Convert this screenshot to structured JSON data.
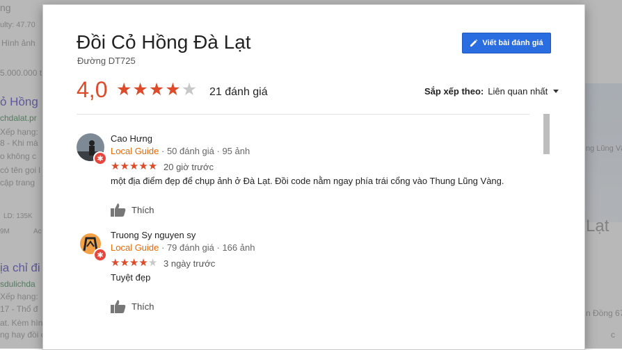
{
  "background": {
    "snippets": [
      "ng",
      "ulty: 47.70",
      "Hình ảnh",
      "5.000.000 t",
      "ỏ Hồng",
      "chdalat.pr",
      "Xếp hạng:",
      "8 - Khi mà",
      "o không c",
      "có tên gọi l",
      "cập trang",
      "LD: 135K",
      "9M",
      "Ac",
      "ịa chỉ đi",
      "sdulichda",
      "Xếp hạng:",
      "17 - Thổ đ",
      "at. Kèm hìn",
      "ng hay đồi c",
      "ng Lũng Vàn",
      "Lạt",
      "n Đồng 67",
      "c"
    ]
  },
  "dialog": {
    "place_name": "Đồi Cỏ Hồng Đà Lạt",
    "address": "Đường DT725",
    "write_review_label": "Viết bài đánh giá",
    "rating": "4,0",
    "rating_value": 4,
    "review_count_label": "21 đánh giá",
    "sort_label": "Sắp xếp theo:",
    "sort_value": "Liên quan nhất"
  },
  "reviews": [
    {
      "name": "Cao Hưng",
      "guide_label": "Local Guide",
      "stats": " · 50 đánh giá · 95 ảnh",
      "stars": 5,
      "time": "20 giờ trước",
      "text": "một địa điểm đẹp để chụp ảnh ở Đà Lạt. Đồi code nằm ngay phía trái cổng vào Thung Lũng Vàng.",
      "like_label": "Thích"
    },
    {
      "name": "Truong Sy nguyen sy",
      "guide_label": "Local Guide",
      "stats": " · 79 đánh giá · 166 ảnh",
      "stars": 4,
      "time": "3 ngày trước",
      "text": "Tuyệt đẹp",
      "like_label": "Thích"
    }
  ],
  "colors": {
    "accent_button": "#2a6de0",
    "star": "#dd4b2a",
    "local_guide": "#e56a00"
  }
}
